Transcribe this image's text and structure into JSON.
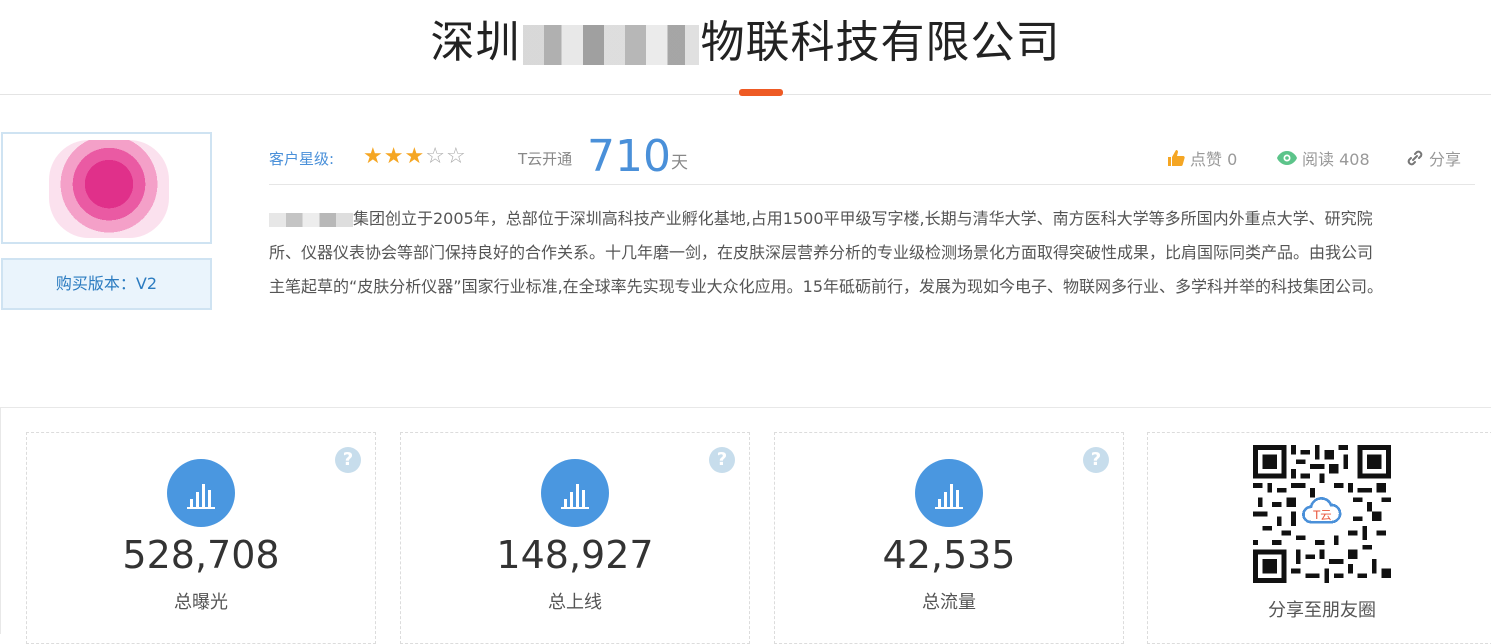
{
  "company": {
    "title_prefix": "深圳",
    "title_suffix": "物联科技有限公司"
  },
  "profile": {
    "version_label": "购买版本：V2"
  },
  "rating": {
    "label": "客户星级:",
    "stars_filled": 3,
    "stars_total": 5,
    "tyun_label": "T云开通",
    "tyun_days": "710",
    "tyun_unit": "天"
  },
  "actions": {
    "like_label": "点赞 0",
    "read_label": "阅读 408",
    "share_label": "分享"
  },
  "description": {
    "line1_rest": "集团创立于2005年，总部位于深圳高科技产业孵化基地,占用1500平甲级写字楼,长期与清华大学、南方医科大学等多所国内外重点大学、研究院",
    "line2": "所、仪器仪表协会等部门保持良好的合作关系。十几年磨一剑，在皮肤深层营养分析的专业级检测场景化方面取得突破性成果，比肩国际同类产品。由我公司",
    "line3": "主笔起草的“皮肤分析仪器”国家行业标准,在全球率先实现专业大众化应用。15年砥砺前行，发展为现如今电子、物联网多行业、多学科并举的科技集团公司。"
  },
  "stats": [
    {
      "value": "528,708",
      "label": "总曝光"
    },
    {
      "value": "148,927",
      "label": "总上线"
    },
    {
      "value": "42,535",
      "label": "总流量"
    }
  ],
  "share": {
    "qr_label": "分享至朋友圈",
    "qr_center_text": "T云"
  },
  "colors": {
    "accent": "#4a90d9",
    "underline": "#ee5a24",
    "star": "#f5a623",
    "stat_circle": "#4a97e0"
  }
}
